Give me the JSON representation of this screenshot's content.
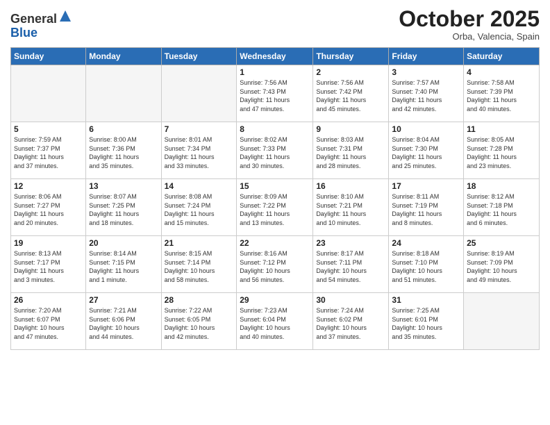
{
  "logo": {
    "general": "General",
    "blue": "Blue"
  },
  "header": {
    "month": "October 2025",
    "location": "Orba, Valencia, Spain"
  },
  "weekdays": [
    "Sunday",
    "Monday",
    "Tuesday",
    "Wednesday",
    "Thursday",
    "Friday",
    "Saturday"
  ],
  "weeks": [
    [
      {
        "day": "",
        "info": ""
      },
      {
        "day": "",
        "info": ""
      },
      {
        "day": "",
        "info": ""
      },
      {
        "day": "1",
        "info": "Sunrise: 7:56 AM\nSunset: 7:43 PM\nDaylight: 11 hours\nand 47 minutes."
      },
      {
        "day": "2",
        "info": "Sunrise: 7:56 AM\nSunset: 7:42 PM\nDaylight: 11 hours\nand 45 minutes."
      },
      {
        "day": "3",
        "info": "Sunrise: 7:57 AM\nSunset: 7:40 PM\nDaylight: 11 hours\nand 42 minutes."
      },
      {
        "day": "4",
        "info": "Sunrise: 7:58 AM\nSunset: 7:39 PM\nDaylight: 11 hours\nand 40 minutes."
      }
    ],
    [
      {
        "day": "5",
        "info": "Sunrise: 7:59 AM\nSunset: 7:37 PM\nDaylight: 11 hours\nand 37 minutes."
      },
      {
        "day": "6",
        "info": "Sunrise: 8:00 AM\nSunset: 7:36 PM\nDaylight: 11 hours\nand 35 minutes."
      },
      {
        "day": "7",
        "info": "Sunrise: 8:01 AM\nSunset: 7:34 PM\nDaylight: 11 hours\nand 33 minutes."
      },
      {
        "day": "8",
        "info": "Sunrise: 8:02 AM\nSunset: 7:33 PM\nDaylight: 11 hours\nand 30 minutes."
      },
      {
        "day": "9",
        "info": "Sunrise: 8:03 AM\nSunset: 7:31 PM\nDaylight: 11 hours\nand 28 minutes."
      },
      {
        "day": "10",
        "info": "Sunrise: 8:04 AM\nSunset: 7:30 PM\nDaylight: 11 hours\nand 25 minutes."
      },
      {
        "day": "11",
        "info": "Sunrise: 8:05 AM\nSunset: 7:28 PM\nDaylight: 11 hours\nand 23 minutes."
      }
    ],
    [
      {
        "day": "12",
        "info": "Sunrise: 8:06 AM\nSunset: 7:27 PM\nDaylight: 11 hours\nand 20 minutes."
      },
      {
        "day": "13",
        "info": "Sunrise: 8:07 AM\nSunset: 7:25 PM\nDaylight: 11 hours\nand 18 minutes."
      },
      {
        "day": "14",
        "info": "Sunrise: 8:08 AM\nSunset: 7:24 PM\nDaylight: 11 hours\nand 15 minutes."
      },
      {
        "day": "15",
        "info": "Sunrise: 8:09 AM\nSunset: 7:22 PM\nDaylight: 11 hours\nand 13 minutes."
      },
      {
        "day": "16",
        "info": "Sunrise: 8:10 AM\nSunset: 7:21 PM\nDaylight: 11 hours\nand 10 minutes."
      },
      {
        "day": "17",
        "info": "Sunrise: 8:11 AM\nSunset: 7:19 PM\nDaylight: 11 hours\nand 8 minutes."
      },
      {
        "day": "18",
        "info": "Sunrise: 8:12 AM\nSunset: 7:18 PM\nDaylight: 11 hours\nand 6 minutes."
      }
    ],
    [
      {
        "day": "19",
        "info": "Sunrise: 8:13 AM\nSunset: 7:17 PM\nDaylight: 11 hours\nand 3 minutes."
      },
      {
        "day": "20",
        "info": "Sunrise: 8:14 AM\nSunset: 7:15 PM\nDaylight: 11 hours\nand 1 minute."
      },
      {
        "day": "21",
        "info": "Sunrise: 8:15 AM\nSunset: 7:14 PM\nDaylight: 10 hours\nand 58 minutes."
      },
      {
        "day": "22",
        "info": "Sunrise: 8:16 AM\nSunset: 7:12 PM\nDaylight: 10 hours\nand 56 minutes."
      },
      {
        "day": "23",
        "info": "Sunrise: 8:17 AM\nSunset: 7:11 PM\nDaylight: 10 hours\nand 54 minutes."
      },
      {
        "day": "24",
        "info": "Sunrise: 8:18 AM\nSunset: 7:10 PM\nDaylight: 10 hours\nand 51 minutes."
      },
      {
        "day": "25",
        "info": "Sunrise: 8:19 AM\nSunset: 7:09 PM\nDaylight: 10 hours\nand 49 minutes."
      }
    ],
    [
      {
        "day": "26",
        "info": "Sunrise: 7:20 AM\nSunset: 6:07 PM\nDaylight: 10 hours\nand 47 minutes."
      },
      {
        "day": "27",
        "info": "Sunrise: 7:21 AM\nSunset: 6:06 PM\nDaylight: 10 hours\nand 44 minutes."
      },
      {
        "day": "28",
        "info": "Sunrise: 7:22 AM\nSunset: 6:05 PM\nDaylight: 10 hours\nand 42 minutes."
      },
      {
        "day": "29",
        "info": "Sunrise: 7:23 AM\nSunset: 6:04 PM\nDaylight: 10 hours\nand 40 minutes."
      },
      {
        "day": "30",
        "info": "Sunrise: 7:24 AM\nSunset: 6:02 PM\nDaylight: 10 hours\nand 37 minutes."
      },
      {
        "day": "31",
        "info": "Sunrise: 7:25 AM\nSunset: 6:01 PM\nDaylight: 10 hours\nand 35 minutes."
      },
      {
        "day": "",
        "info": ""
      }
    ]
  ]
}
